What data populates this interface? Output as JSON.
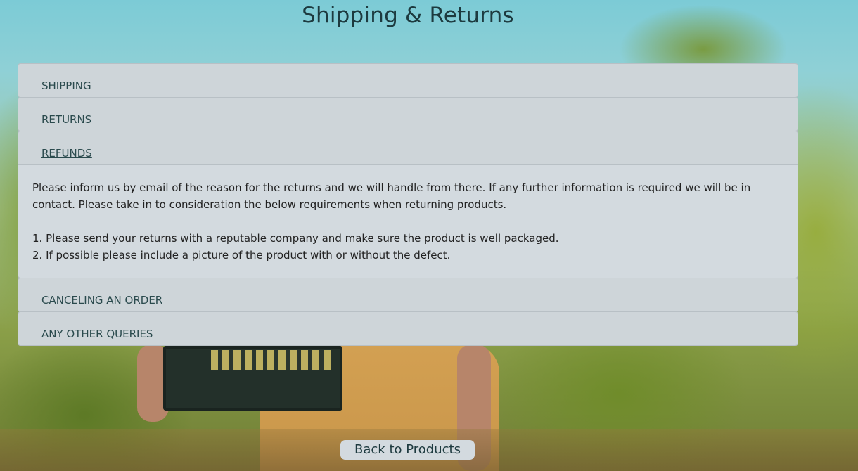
{
  "page": {
    "title": "Shipping & Returns"
  },
  "accordion": {
    "items": [
      {
        "label": "SHIPPING",
        "expanded": false
      },
      {
        "label": "RETURNS",
        "expanded": false
      },
      {
        "label": "REFUNDS",
        "expanded": true
      },
      {
        "label": "CANCELING AN ORDER",
        "expanded": false
      },
      {
        "label": "ANY OTHER QUERIES",
        "expanded": false
      }
    ],
    "refunds_body": {
      "paragraph": "Please inform us by email of the reason for the returns and we will handle from there. If any further information is required we will be in contact. Please take in to consideration the below requirements when returning products.",
      "item_1": "1. Please send your returns with a reputable company and make sure the product is well packaged.",
      "item_2": "2. If possible please include a picture of the product with or without the defect."
    }
  },
  "footer": {
    "back_label": "Back to Products"
  },
  "colors": {
    "panel": "#ced5d9",
    "text": "#1d3a3f"
  }
}
